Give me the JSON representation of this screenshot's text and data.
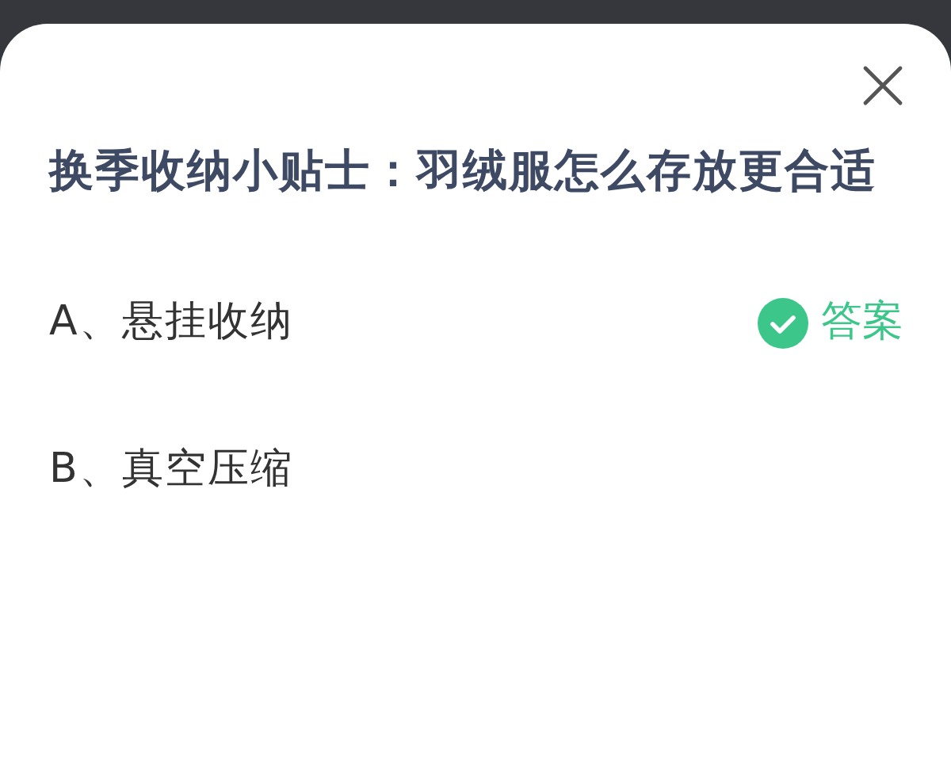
{
  "question": {
    "title": "换季收纳小贴士：羽绒服怎么存放更合适"
  },
  "options": [
    {
      "label": "A、悬挂收纳",
      "correct": true,
      "answer_label": "答案"
    },
    {
      "label": "B、真空压缩",
      "correct": false
    }
  ]
}
